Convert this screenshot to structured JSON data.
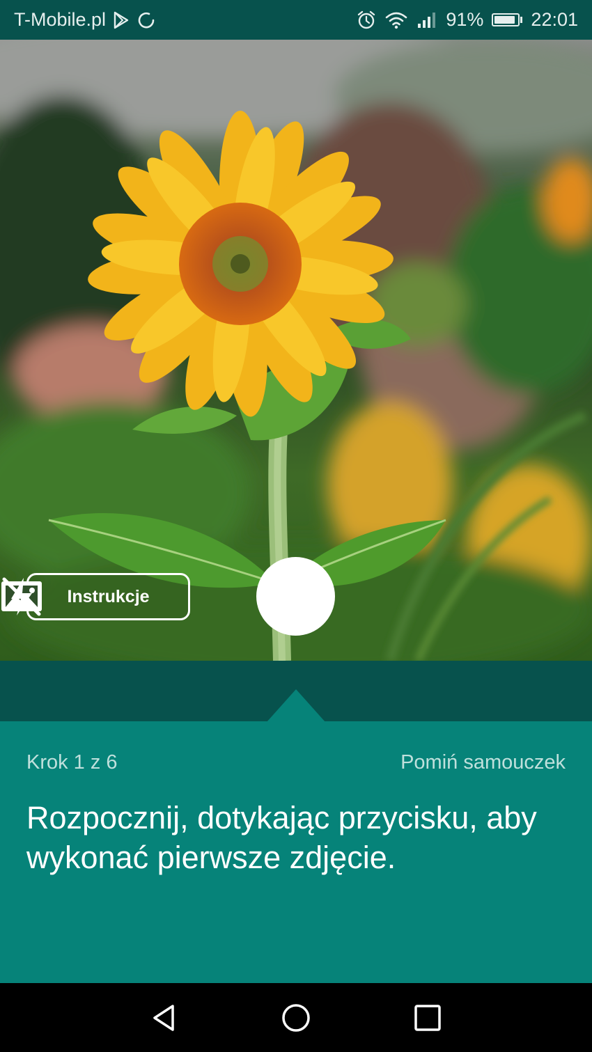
{
  "status_bar": {
    "carrier": "T-Mobile.pl",
    "battery_percent": "91%",
    "battery_level": 0.91,
    "time": "22:01",
    "icons": [
      "play-store-icon",
      "sync-icon",
      "alarm-icon",
      "wifi-icon",
      "signal-icon",
      "battery-icon"
    ]
  },
  "camera": {
    "instructions_label": "Instrukcje",
    "shutter_icon": "shutter-button",
    "gallery_icon": "gallery-icon",
    "flash_icon": "flash-off-icon"
  },
  "tutorial": {
    "step": "Krok 1 z 6",
    "skip": "Pomiń samouczek",
    "message": "Rozpocznij, dotykając przycisku, aby wykonać pierwsze zdjęcie."
  },
  "nav": {
    "icons": [
      "back-icon",
      "home-icon",
      "recents-icon"
    ]
  },
  "colors": {
    "status_bar": "#07524d",
    "panel_dark": "#07524d",
    "panel": "#068379",
    "secondary_text": "#bfe0dc"
  }
}
